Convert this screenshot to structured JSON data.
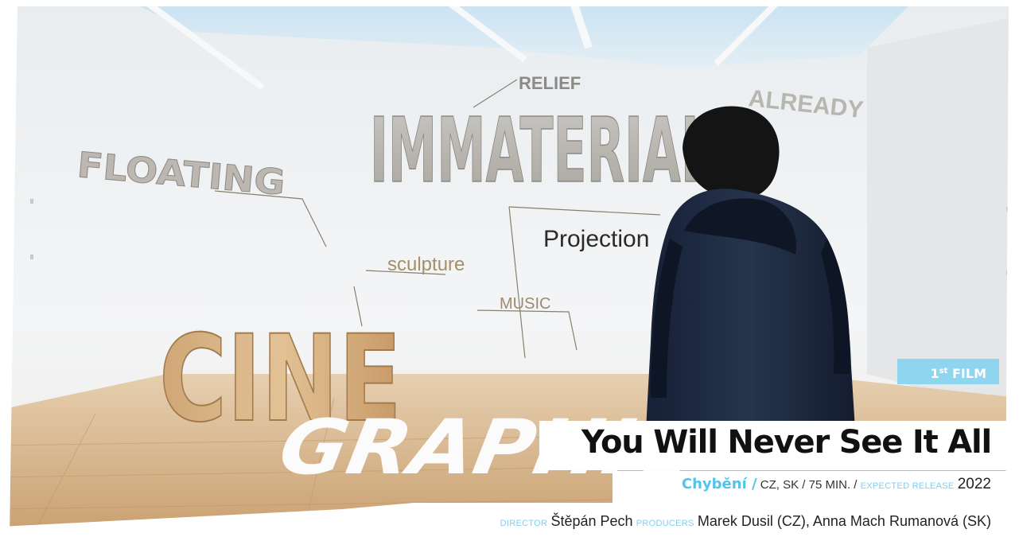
{
  "badge": {
    "number": "1",
    "suffix": "st",
    "label": "FILM"
  },
  "film": {
    "title": "You Will Never See It All",
    "original_title": "Chybění /",
    "details": "CZ, SK / 75 MIN. /",
    "release_label": "EXPECTED RELEASE",
    "release_year": "2022"
  },
  "credits": {
    "director_label": "DIRECTOR",
    "director": "Štěpán Pech",
    "producers_label": "PRODUCERS",
    "producers": "Marek Dusil (CZ), Anna Mach Rumanová (SK)"
  },
  "photo_words": {
    "relief": "RELIEF",
    "already": "ALREADY",
    "immaterial": "IMMATERIAL",
    "floating": "FLOATING",
    "projection": "Projection",
    "sculpture": "sculpture",
    "music": "MUSIC",
    "cine": "CINE",
    "graphic": "GRAPHIC"
  },
  "colors": {
    "accent": "#52c3ec",
    "badge_bg": "#8fd5f0",
    "wood": "#d9b588",
    "jacket": "#1d2a3f"
  }
}
